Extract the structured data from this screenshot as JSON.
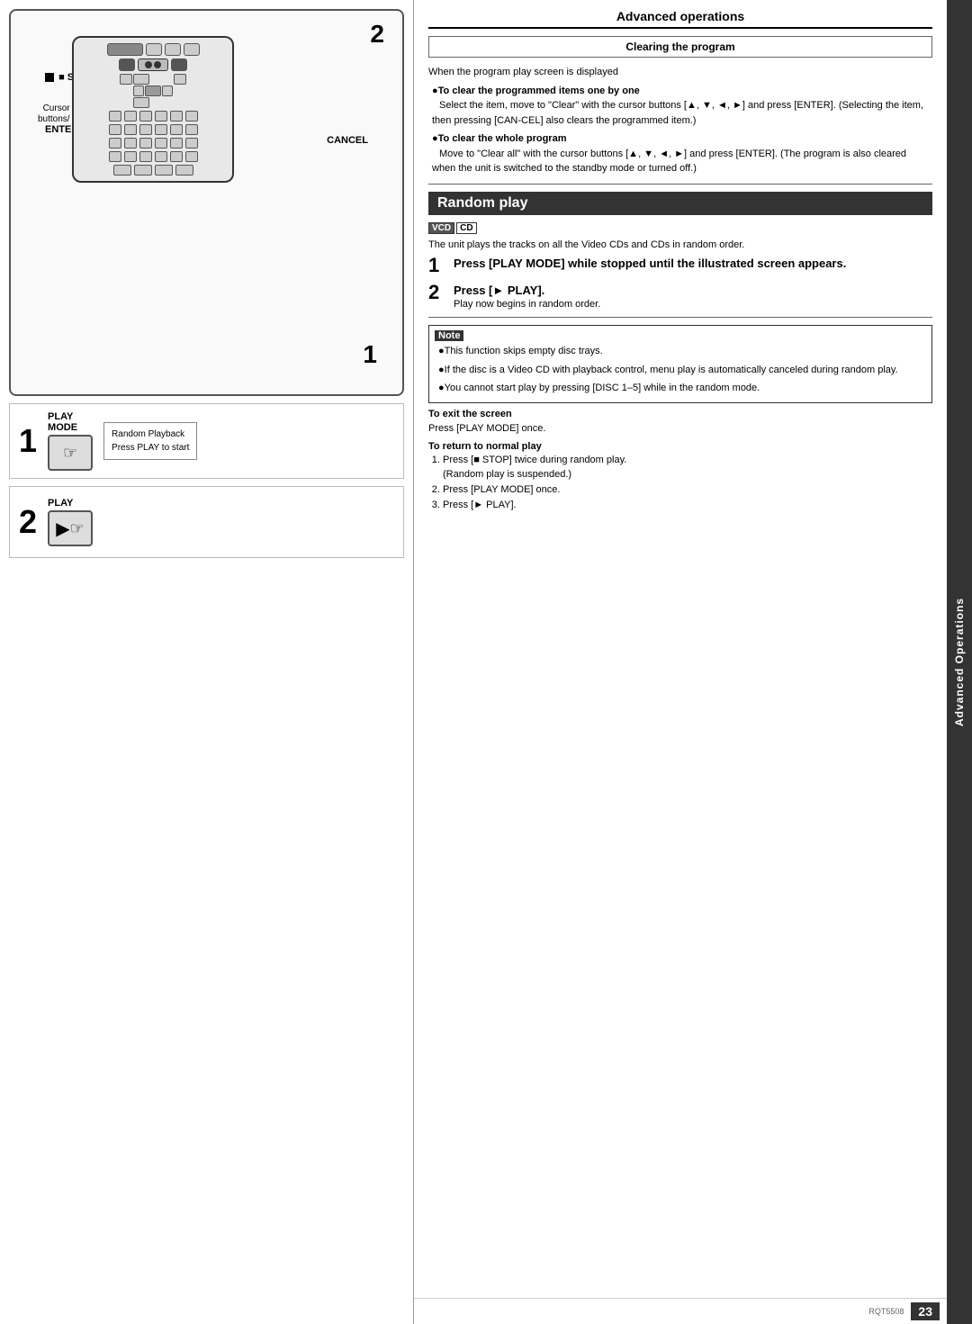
{
  "left_panel": {
    "step2_label": "2",
    "remote": {
      "stop_label": "■ STOP",
      "cursor_label": "Cursor",
      "buttons_label": "buttons/",
      "enter_label": "ENTER",
      "cancel_label": "CANCEL"
    },
    "step1": {
      "number": "1",
      "play_mode_label": "PLAY",
      "play_mode_sub": "MODE",
      "screen_line1": "Random Playback",
      "screen_line2": "Press PLAY to start"
    },
    "step2": {
      "number": "2",
      "play_label": "PLAY"
    }
  },
  "right_panel": {
    "section_header": "Advanced operations",
    "clearing": {
      "title": "Clearing the program",
      "intro": "When the program play screen is displayed",
      "bullet1_title": "To clear the programmed items one by one",
      "bullet1_text": "Select the item, move to \"Clear\" with the cursor buttons [▲, ▼, ◄, ►] and press [ENTER]. (Selecting the item, then pressing [CAN-CEL] also clears the programmed item.)",
      "bullet2_title": "To clear the whole program",
      "bullet2_text": "Move to \"Clear all\" with the cursor buttons [▲, ▼, ◄, ►] and press [ENTER]. (The program is also cleared when the unit is switched to the standby mode or turned off.)"
    },
    "random_play": {
      "title": "Random play",
      "vcd_badge": "VCD",
      "cd_badge": "CD",
      "intro": "The unit plays the tracks on all the Video CDs and CDs in random order.",
      "step1_text": "Press [PLAY MODE] while stopped until the illustrated screen appears.",
      "step2_text": "Press [► PLAY].",
      "step2_sub": "Play now begins in random order.",
      "note_title": "Note",
      "note_bullets": [
        "This function skips empty disc trays.",
        "If the disc is a Video CD with playback control, menu play is automatically canceled during random play.",
        "You cannot start play by pressing [DISC 1–5] while in the random mode."
      ],
      "to_exit_title": "To exit the screen",
      "to_exit_text": "Press [PLAY MODE] once.",
      "to_return_title": "To return to normal play",
      "to_return_steps": [
        "Press [■ STOP] twice during random play.",
        "(Random play is suspended.)",
        "Press [PLAY MODE] once.",
        "Press [► PLAY]."
      ]
    },
    "side_tab": "Advanced Operations",
    "page_number": "23",
    "model_number": "RQT5508"
  }
}
